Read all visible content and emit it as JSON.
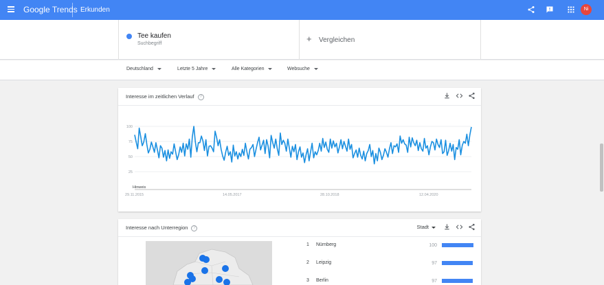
{
  "header": {
    "logo_google": "Google",
    "logo_trends": "Trends",
    "section": "Erkunden",
    "avatar_initials": "Ni",
    "icons": [
      "menu-icon",
      "share-icon",
      "feedback-icon",
      "apps-icon"
    ]
  },
  "term": {
    "name": "Tee kaufen",
    "type": "Suchbegriff",
    "color": "#4285f4"
  },
  "compare": {
    "label": "Vergleichen"
  },
  "filters": {
    "country": "Deutschland",
    "period": "Letzte 5 Jahre",
    "category": "Alle Kategorien",
    "search_type": "Websuche"
  },
  "interest_over_time": {
    "title": "Interesse im zeitlichen Verlauf",
    "note": "Hinweis",
    "icons": [
      "help-icon",
      "download-icon",
      "embed-icon",
      "share-icon"
    ]
  },
  "interest_by_region": {
    "title": "Interesse nach Unterregion",
    "resolution": "Stadt",
    "icons": [
      "help-icon",
      "download-icon",
      "embed-icon",
      "share-icon"
    ],
    "rows": [
      {
        "rank": "1",
        "name": "Nürnberg",
        "value": "100"
      },
      {
        "rank": "2",
        "name": "Leipzig",
        "value": "97"
      },
      {
        "rank": "3",
        "name": "Berlin",
        "value": "97"
      }
    ]
  },
  "chart_data": {
    "type": "line",
    "title": "",
    "xlabel": "",
    "ylabel": "",
    "ylim": [
      0,
      100
    ],
    "y_ticks": [
      "100",
      "75",
      "50",
      "25"
    ],
    "x_ticks": [
      "29.11.2015",
      "14.05.2017",
      "28.10.2018",
      "12.04.2020"
    ],
    "grid": true,
    "color": "#1a8fe0",
    "series": [
      {
        "values": [
          86,
          74,
          63,
          97,
          83,
          68,
          74,
          88,
          70,
          56,
          62,
          74,
          66,
          57,
          73,
          61,
          48,
          68,
          64,
          49,
          60,
          43,
          61,
          47,
          58,
          54,
          71,
          58,
          45,
          53,
          66,
          57,
          72,
          51,
          71,
          62,
          79,
          49,
          83,
          100,
          74,
          58,
          73,
          73,
          84,
          76,
          60,
          78,
          51,
          67,
          68,
          64,
          58,
          92,
          82,
          68,
          78,
          62,
          51,
          44,
          57,
          67,
          52,
          58,
          41,
          69,
          51,
          58,
          46,
          56,
          50,
          62,
          52,
          72,
          58,
          46,
          62,
          65,
          70,
          50,
          62,
          73,
          82,
          61,
          69,
          77,
          55,
          78,
          67,
          48,
          85,
          73,
          64,
          79,
          63,
          52,
          89,
          70,
          77,
          72,
          59,
          79,
          64,
          49,
          67,
          58,
          70,
          45,
          58,
          66,
          49,
          56,
          40,
          53,
          63,
          43,
          58,
          72,
          48,
          58,
          53,
          60,
          72,
          59,
          80,
          65,
          74,
          62,
          57,
          79,
          64,
          76,
          66,
          72,
          56,
          66,
          78,
          63,
          75,
          67,
          59,
          79,
          62,
          70,
          48,
          55,
          61,
          49,
          64,
          52,
          46,
          59,
          43,
          55,
          60,
          70,
          50,
          60,
          38,
          55,
          43,
          64,
          57,
          45,
          52,
          63,
          57,
          49,
          63,
          73,
          55,
          68,
          66,
          71,
          57,
          84,
          72,
          78,
          71,
          69,
          57,
          82,
          66,
          81,
          73,
          68,
          77,
          60,
          73,
          63,
          59,
          80,
          64,
          68,
          53,
          66,
          75,
          73,
          61,
          79,
          70,
          65,
          78,
          55,
          58,
          77,
          52,
          60,
          72,
          59,
          70,
          45,
          65,
          62,
          78,
          53,
          69,
          75,
          72,
          87,
          68,
          86,
          99
        ]
      }
    ]
  }
}
